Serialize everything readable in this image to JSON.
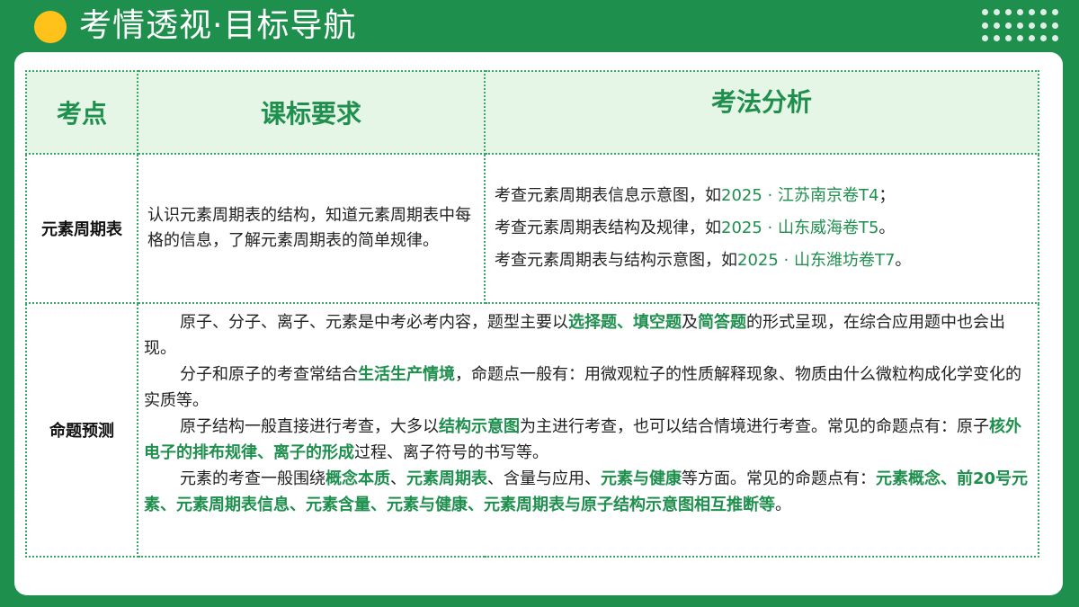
{
  "header": {
    "title": "考情透视·目标导航"
  },
  "table": {
    "headers": [
      "考点",
      "课标要求",
      "考法分析"
    ],
    "row1": {
      "label": "元素周期表",
      "requirement": "认识元素周期表的结构，知道元素周期表中每格的信息，了解元素周期表的简单规律。",
      "analysis": [
        {
          "text": "考查元素周期表信息示意图，如",
          "ref": "2025 · 江苏南京卷T4",
          "end": "；"
        },
        {
          "text": "考查元素周期表结构及规律，如",
          "ref": "2025 · 山东威海卷T5",
          "end": "。"
        },
        {
          "text": "考查元素周期表与结构示意图，如",
          "ref": "2025 · 山东潍坊卷T7",
          "end": "。"
        }
      ]
    },
    "row2": {
      "label": "命题预测",
      "p1": {
        "a": "原子、分子、离子、元素是中考必考内容，题型主要以",
        "h1": "选择题",
        "b": "、",
        "h2": "填空题",
        "c": "及",
        "h3": "简答题",
        "d": "的形式呈现，在综合应用题中也会出现。"
      },
      "p2": {
        "a": "分子和原子的考查常结合",
        "h1": "生活生产情境",
        "b": "，命题点一般有：用微观粒子的性质解释现象、物质由什么微粒构成化学变化的实质等。"
      },
      "p3": {
        "a": "原子结构一般直接进行考查，大多以",
        "h1": "结构示意图",
        "b": "为主进行考查，也可以结合情境进行考查。常见的命题点有：原子",
        "h2": "核外电子的排布规律",
        "c": "、",
        "h3": "离子的形成",
        "d": "过程、离子符号的书写等。"
      },
      "p4": {
        "a": "元素的考查一般围绕",
        "h1": "概念本质",
        "b": "、",
        "h2": "元素周期表",
        "c": "、含量与应用、",
        "h3": "元素与健康",
        "d": "等方面。常见的命题点有：",
        "h4": "元素概念、前20号元素、元素周期表信息、元素含量、元素与健康、元素周期表与原子结构示意图相互推断等",
        "e": "。"
      }
    }
  },
  "colors": {
    "brand_green": "#1f8f4e",
    "accent_yellow": "#ffc21a",
    "header_fill": "#e6f6e6"
  }
}
